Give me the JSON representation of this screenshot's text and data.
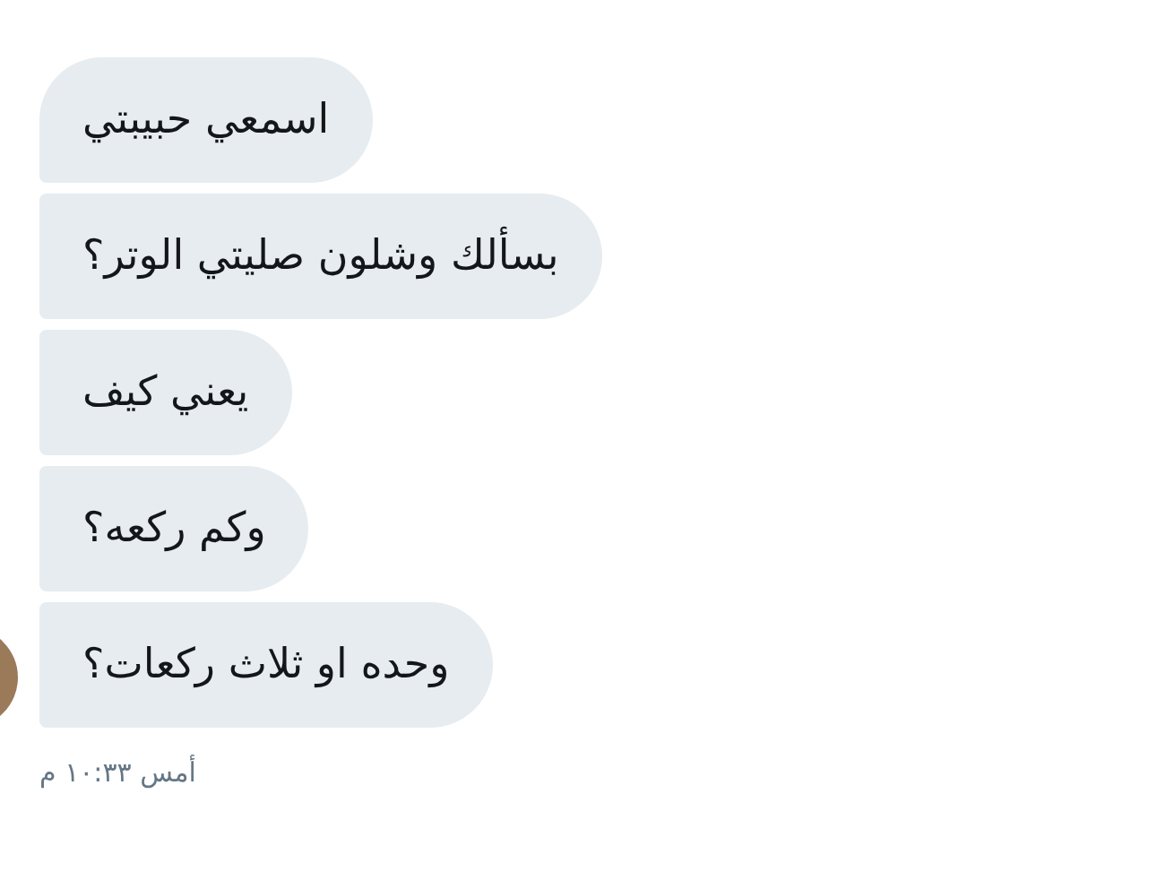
{
  "messages": [
    {
      "text": "اسمعي حبيبتي"
    },
    {
      "text": "بسألك وشلون صليتي الوتر؟"
    },
    {
      "text": "يعني كيف"
    },
    {
      "text": "وكم ركعه؟"
    },
    {
      "text": "وحده او ثلاث ركعات؟"
    }
  ],
  "timestamp": "أمس ١٠:٣٣ م"
}
